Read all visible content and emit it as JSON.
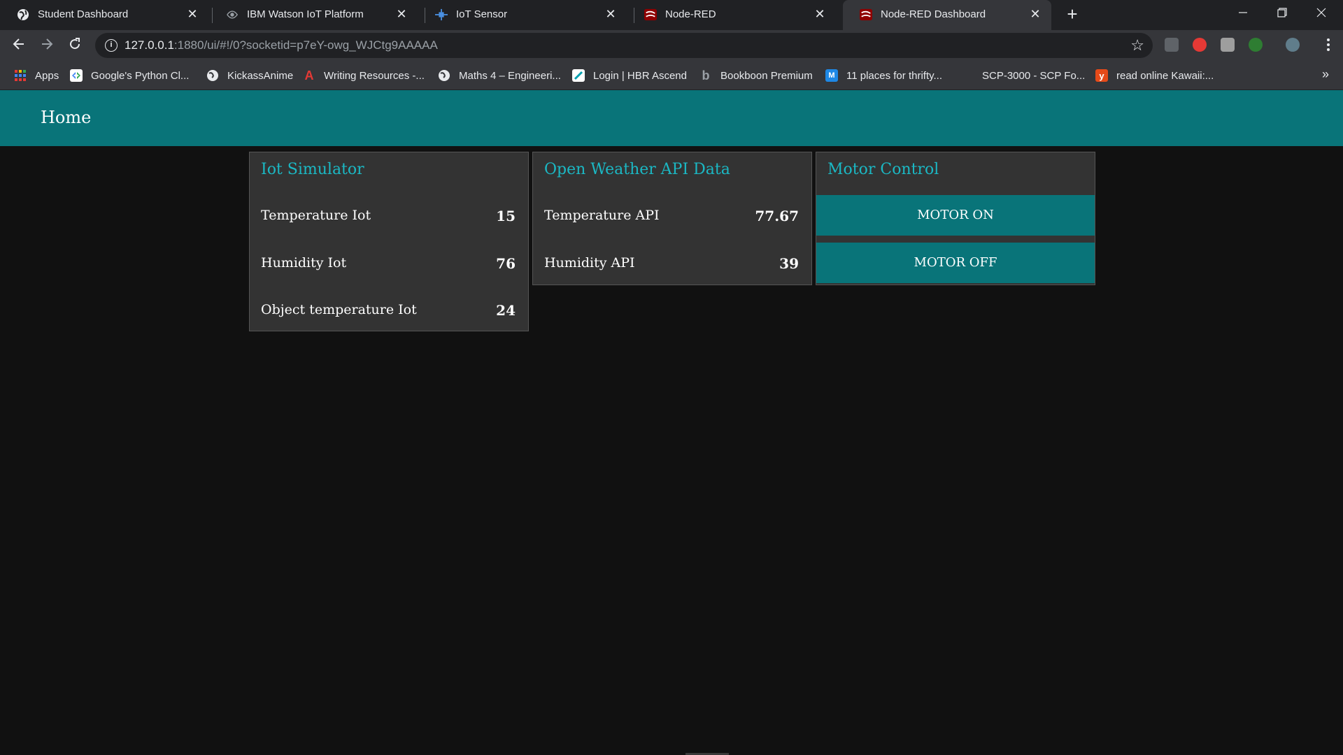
{
  "browser": {
    "tabs": [
      {
        "title": "Student Dashboard",
        "icon": "globe-icon"
      },
      {
        "title": "IBM Watson IoT Platform",
        "icon": "watson-icon"
      },
      {
        "title": "IoT Sensor",
        "icon": "iot-icon"
      },
      {
        "title": "Node-RED",
        "icon": "node-red-icon"
      },
      {
        "title": "Node-RED Dashboard",
        "icon": "node-red-icon",
        "active": true
      }
    ],
    "close_glyph": "✕",
    "new_tab_glyph": "+",
    "url": {
      "host": "127.0.0.1",
      "path": ":1880/ui/#!/0?socketid=p7eY-owg_WJCtg9AAAAA"
    },
    "bookmarks": [
      {
        "label": "Apps",
        "icon": "apps-grid-icon"
      },
      {
        "label": "Google's Python Cl...",
        "icon": "google-dev-icon"
      },
      {
        "label": "KickassAnime",
        "icon": "globe-icon"
      },
      {
        "label": "Writing Resources -...",
        "icon": "acrobat-icon"
      },
      {
        "label": "Maths 4 – Engineeri...",
        "icon": "globe-icon"
      },
      {
        "label": "Login | HBR Ascend",
        "icon": "hbr-icon"
      },
      {
        "label": "Bookboon Premium",
        "icon": "bookboon-icon"
      },
      {
        "label": "11 places for thrifty...",
        "icon": "m-icon"
      },
      {
        "label": "SCP-3000 - SCP Fo...",
        "icon": "blank-icon"
      },
      {
        "label": "read online Kawaii:...",
        "icon": "tumblr-icon"
      }
    ],
    "more_glyph": "»",
    "colors": {
      "tabstrip": "#202124",
      "toolbar": "#35363a"
    }
  },
  "dashboard": {
    "header_title": "Home",
    "colors": {
      "accent": "#097479",
      "title": "#1bb8c4",
      "card": "#333333",
      "background": "#111111"
    },
    "groups": {
      "iot": {
        "title": "Iot Simulator",
        "rows": [
          {
            "label": "Temperature Iot",
            "value": "15"
          },
          {
            "label": "Humidity Iot",
            "value": "76"
          },
          {
            "label": "Object temperature Iot",
            "value": "24"
          }
        ]
      },
      "weather": {
        "title": "Open Weather API Data",
        "rows": [
          {
            "label": "Temperature API",
            "value": "77.67"
          },
          {
            "label": "Humidity API",
            "value": "39"
          }
        ]
      },
      "motor": {
        "title": "Motor Control",
        "on_label": "MOTOR ON",
        "off_label": "MOTOR OFF"
      }
    }
  }
}
